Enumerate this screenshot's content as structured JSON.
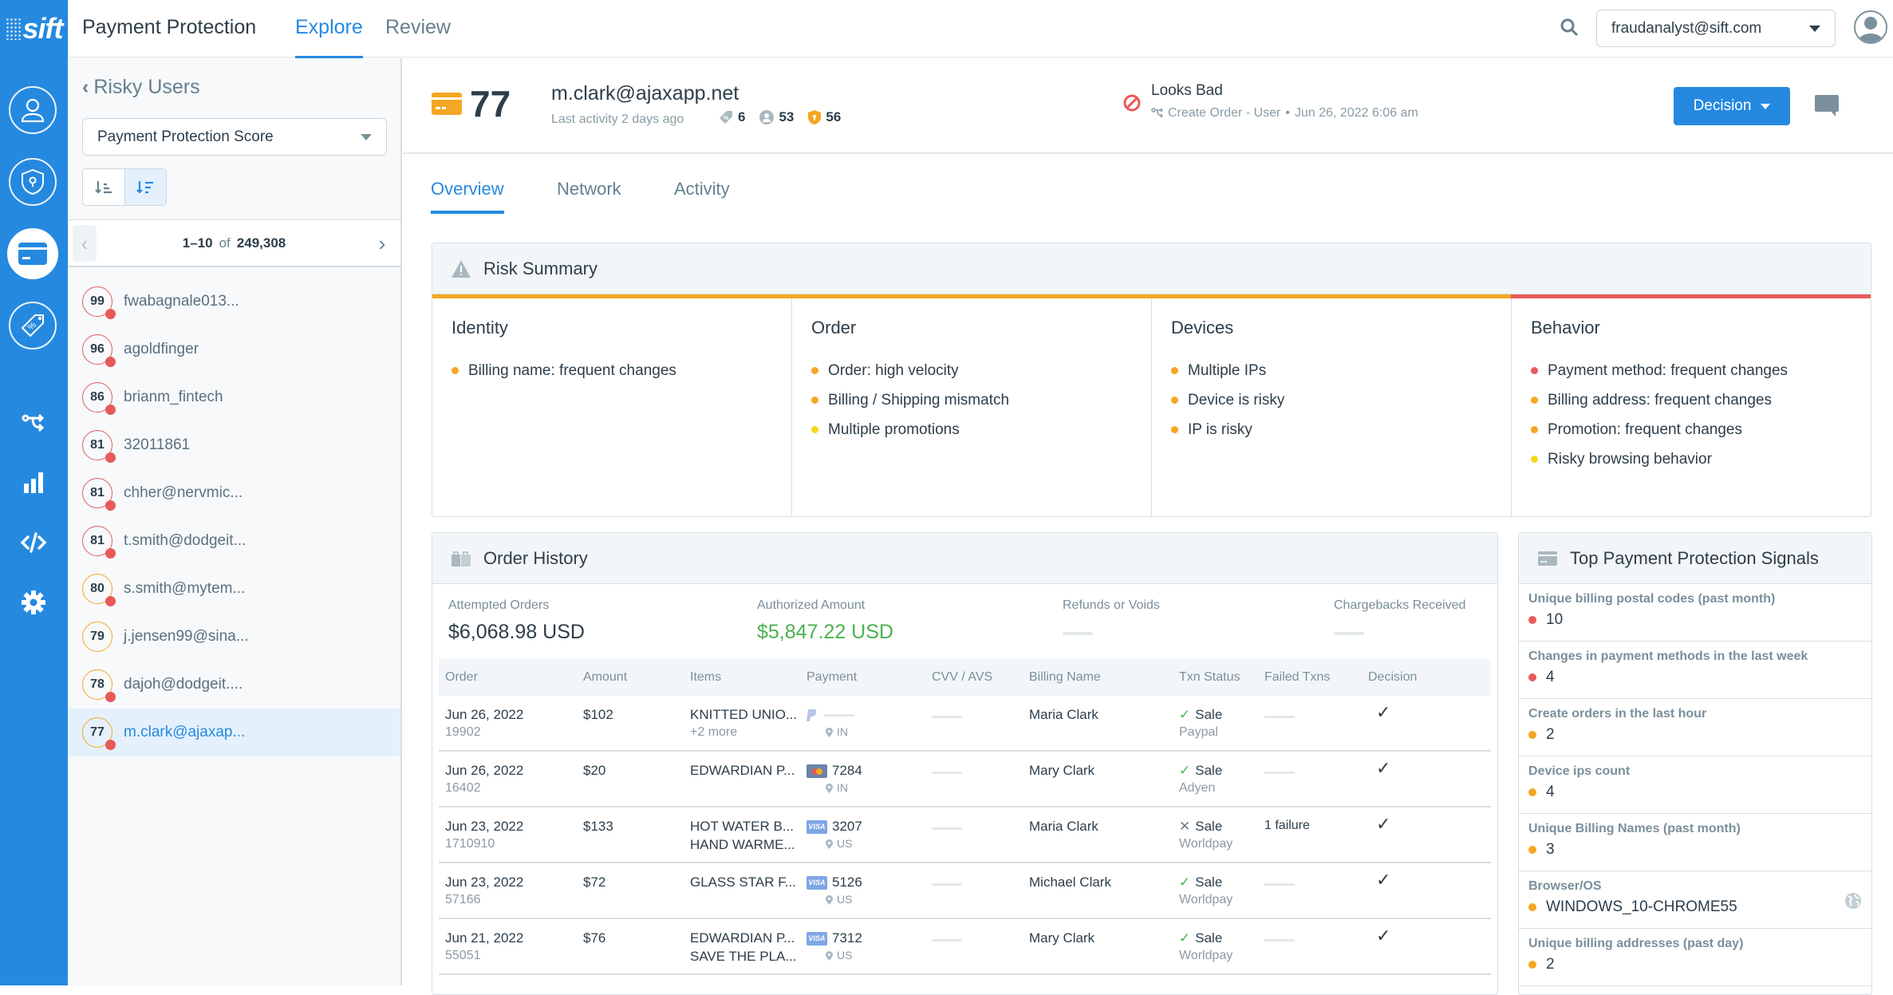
{
  "app": {
    "logo": "sift",
    "title": "Payment Protection",
    "nav_tabs": [
      {
        "label": "Explore",
        "active": true
      },
      {
        "label": "Review",
        "active": false
      }
    ],
    "account": "fraudanalyst@sift.com"
  },
  "rail": {
    "items": [
      "user-icon",
      "shield-keyhole-icon",
      "credit-card-icon",
      "promo-tag-icon",
      "workflow-icon",
      "bar-chart-icon",
      "code-icon",
      "gear-icon"
    ],
    "active": "credit-card-icon"
  },
  "left_panel": {
    "back_label": "Risky Users",
    "sort_field": "Payment Protection Score",
    "pager": {
      "range": "1–10",
      "of": "of",
      "total": "249,308"
    },
    "users": [
      {
        "score": "99",
        "name": "fwabagnale013...",
        "level": "red",
        "flag": true
      },
      {
        "score": "96",
        "name": "agoldfinger",
        "level": "red",
        "flag": true
      },
      {
        "score": "86",
        "name": "brianm_fintech",
        "level": "red",
        "flag": true
      },
      {
        "score": "81",
        "name": "32011861",
        "level": "red",
        "flag": true
      },
      {
        "score": "81",
        "name": "chher@nervmic...",
        "level": "red",
        "flag": true
      },
      {
        "score": "81",
        "name": "t.smith@dodgeit...",
        "level": "red",
        "flag": true
      },
      {
        "score": "80",
        "name": "s.smith@mytem...",
        "level": "orange",
        "flag": true
      },
      {
        "score": "79",
        "name": "j.jensen99@sina...",
        "level": "orange",
        "flag": false
      },
      {
        "score": "78",
        "name": "dajoh@dodgeit....",
        "level": "orange",
        "flag": true
      },
      {
        "score": "77",
        "name": "m.clark@ajaxap...",
        "level": "orange",
        "flag": true,
        "selected": true
      }
    ]
  },
  "user_header": {
    "score": "77",
    "email": "m.clark@ajaxapp.net",
    "last_activity": "Last activity 2 days ago",
    "stats": {
      "promotions": "6",
      "accounts": "53",
      "account_takeover": "56"
    },
    "verdict": "Looks Bad",
    "verdict_source": "Create Order - User",
    "verdict_time": "Jun 26, 2022 6:06 am",
    "decision_label": "Decision"
  },
  "tabs": [
    {
      "label": "Overview",
      "active": true
    },
    {
      "label": "Network",
      "active": false
    },
    {
      "label": "Activity",
      "active": false
    }
  ],
  "colors": {
    "red": "#e85a5a",
    "orange": "#f5a623",
    "yellow": "#f8d81c",
    "accent": "#2589e0",
    "green": "#4cb050"
  },
  "risk_summary": {
    "title": "Risk Summary",
    "columns": [
      {
        "title": "Identity",
        "bar": "orange",
        "items": [
          {
            "text": "Billing name: frequent changes",
            "level": "orange"
          }
        ]
      },
      {
        "title": "Order",
        "bar": "orange",
        "items": [
          {
            "text": "Order: high velocity",
            "level": "orange"
          },
          {
            "text": "Billing / Shipping mismatch",
            "level": "orange"
          },
          {
            "text": "Multiple promotions",
            "level": "yellow"
          }
        ]
      },
      {
        "title": "Devices",
        "bar": "orange",
        "items": [
          {
            "text": "Multiple IPs",
            "level": "orange"
          },
          {
            "text": "Device is risky",
            "level": "orange"
          },
          {
            "text": "IP is risky",
            "level": "orange"
          }
        ]
      },
      {
        "title": "Behavior",
        "bar": "red",
        "items": [
          {
            "text": "Payment method: frequent changes",
            "level": "red"
          },
          {
            "text": "Billing address: frequent changes",
            "level": "orange"
          },
          {
            "text": "Promotion: frequent changes",
            "level": "orange"
          },
          {
            "text": "Risky browsing behavior",
            "level": "yellow"
          }
        ]
      }
    ]
  },
  "order_history": {
    "title": "Order History",
    "summary": [
      {
        "label": "Attempted Orders",
        "value": "$6,068.98 USD"
      },
      {
        "label": "Authorized Amount",
        "value": "$5,847.22 USD"
      },
      {
        "label": "Refunds or Voids",
        "value": null
      },
      {
        "label": "Chargebacks Received",
        "value": null
      }
    ],
    "columns": [
      "Order",
      "Amount",
      "Items",
      "Payment",
      "CVV / AVS",
      "Billing Name",
      "Txn Status",
      "Failed Txns",
      "Decision"
    ],
    "rows": [
      {
        "date": "Jun 26, 2022",
        "id": "19902",
        "amount": "$102",
        "items": [
          "KNITTED UNIO...",
          "+2 more"
        ],
        "payment_type": "paypal",
        "last4": "",
        "country": "IN",
        "billing": "Maria Clark",
        "status_ok": true,
        "status": "Sale",
        "gateway": "Paypal",
        "failed": "",
        "decision": "approved"
      },
      {
        "date": "Jun 26, 2022",
        "id": "16402",
        "amount": "$20",
        "items": [
          "EDWARDIAN P..."
        ],
        "payment_type": "mastercard",
        "last4": "7284",
        "country": "IN",
        "billing": "Mary Clark",
        "status_ok": true,
        "status": "Sale",
        "gateway": "Adyen",
        "failed": "",
        "decision": "approved"
      },
      {
        "date": "Jun 23, 2022",
        "id": "1710910",
        "amount": "$133",
        "items": [
          "HOT WATER B...",
          "HAND WARME..."
        ],
        "payment_type": "visa",
        "last4": "3207",
        "country": "US",
        "billing": "Maria Clark",
        "status_ok": false,
        "status": "Sale",
        "gateway": "Worldpay",
        "failed": "1 failure",
        "decision": "approved"
      },
      {
        "date": "Jun 23, 2022",
        "id": "57166",
        "amount": "$72",
        "items": [
          "GLASS STAR F..."
        ],
        "payment_type": "visa",
        "last4": "5126",
        "country": "US",
        "billing": "Michael Clark",
        "status_ok": true,
        "status": "Sale",
        "gateway": "Worldpay",
        "failed": "",
        "decision": "approved"
      },
      {
        "date": "Jun 21, 2022",
        "id": "55051",
        "amount": "$76",
        "items": [
          "EDWARDIAN P...",
          "SAVE THE PLA..."
        ],
        "payment_type": "visa",
        "last4": "7312",
        "country": "US",
        "billing": "Mary Clark",
        "status_ok": true,
        "status": "Sale",
        "gateway": "Worldpay",
        "failed": "",
        "decision": "approved"
      }
    ]
  },
  "signals": {
    "title": "Top Payment Protection Signals",
    "items": [
      {
        "label": "Unique billing postal codes (past month)",
        "value": "10",
        "level": "red"
      },
      {
        "label": "Changes in payment methods in the last week",
        "value": "4",
        "level": "red"
      },
      {
        "label": "Create orders in the last hour",
        "value": "2",
        "level": "orange"
      },
      {
        "label": "Device ips count",
        "value": "4",
        "level": "orange"
      },
      {
        "label": "Unique Billing Names (past month)",
        "value": "3",
        "level": "orange"
      },
      {
        "label": "Browser/OS",
        "value": "WINDOWS_10-CHROME55",
        "level": "orange",
        "icon": "globe-icon"
      },
      {
        "label": "Unique billing addresses (past day)",
        "value": "2",
        "level": "orange"
      }
    ]
  }
}
